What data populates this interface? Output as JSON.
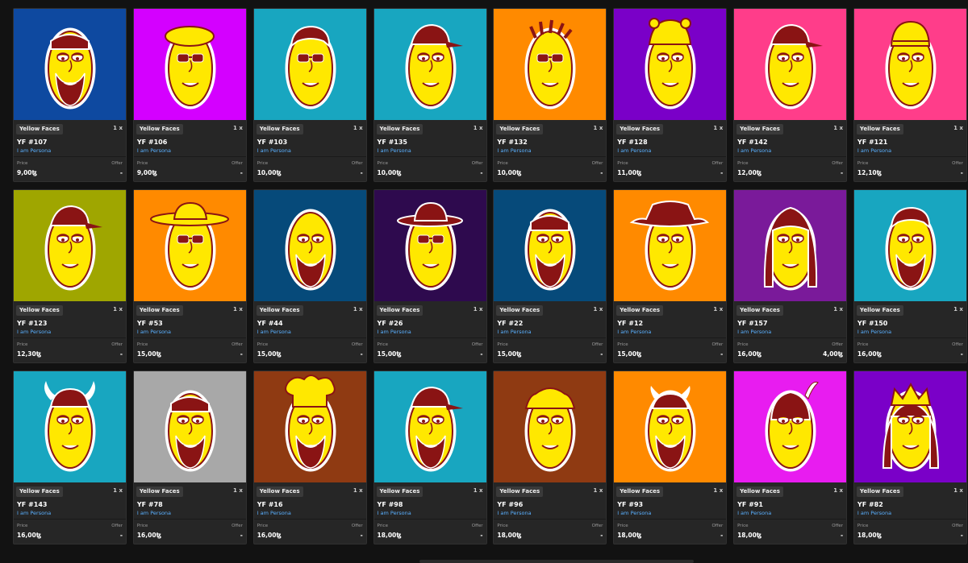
{
  "cards": [
    {
      "bg": "#0e49a0",
      "hat": "bandana",
      "beard": true,
      "glasses": false,
      "title": "YF #107",
      "collection": "Yellow Faces",
      "creator": "I am Persona",
      "qty": "1 x",
      "price_label": "Price",
      "offer_label": "Offer",
      "price": "9,00ꜩ",
      "offer": "-"
    },
    {
      "bg": "#d400ff",
      "hat": "beret",
      "beard": false,
      "glasses": true,
      "title": "YF #106",
      "collection": "Yellow Faces",
      "creator": "I am Persona",
      "qty": "1 x",
      "price_label": "Price",
      "offer_label": "Offer",
      "price": "9,00ꜩ",
      "offer": "-"
    },
    {
      "bg": "#18a6c0",
      "hat": "hair",
      "beard": false,
      "glasses": true,
      "title": "YF #103",
      "collection": "Yellow Faces",
      "creator": "I am Persona",
      "qty": "1 x",
      "price_label": "Price",
      "offer_label": "Offer",
      "price": "10,00ꜩ",
      "offer": "-"
    },
    {
      "bg": "#18a6c0",
      "hat": "cap",
      "beard": false,
      "glasses": false,
      "title": "YF #135",
      "collection": "Yellow Faces",
      "creator": "I am Persona",
      "qty": "1 x",
      "price_label": "Price",
      "offer_label": "Offer",
      "price": "10,00ꜩ",
      "offer": "-"
    },
    {
      "bg": "#ff8a00",
      "hat": "dreads",
      "beard": false,
      "glasses": true,
      "title": "YF #132",
      "collection": "Yellow Faces",
      "creator": "I am Persona",
      "qty": "1 x",
      "price_label": "Price",
      "offer_label": "Offer",
      "price": "10,00ꜩ",
      "offer": "-"
    },
    {
      "bg": "#7a00c8",
      "hat": "bear",
      "beard": false,
      "glasses": false,
      "title": "YF #128",
      "collection": "Yellow Faces",
      "creator": "I am Persona",
      "qty": "1 x",
      "price_label": "Price",
      "offer_label": "Offer",
      "price": "11,00ꜩ",
      "offer": "-"
    },
    {
      "bg": "#ff3d8a",
      "hat": "cap",
      "beard": false,
      "glasses": false,
      "title": "YF #142",
      "collection": "Yellow Faces",
      "creator": "I am Persona",
      "qty": "1 x",
      "price_label": "Price",
      "offer_label": "Offer",
      "price": "12,00ꜩ",
      "offer": "-"
    },
    {
      "bg": "#ff3d8a",
      "hat": "beanie",
      "beard": false,
      "glasses": false,
      "title": "YF #121",
      "collection": "Yellow Faces",
      "creator": "I am Persona",
      "qty": "1 x",
      "price_label": "Price",
      "offer_label": "Offer",
      "price": "12,10ꜩ",
      "offer": "-"
    },
    {
      "bg": "#9fa600",
      "hat": "cap",
      "beard": false,
      "glasses": false,
      "title": "YF #123",
      "collection": "Yellow Faces",
      "creator": "I am Persona",
      "qty": "1 x",
      "price_label": "Price",
      "offer_label": "Offer",
      "price": "12,30ꜩ",
      "offer": "-"
    },
    {
      "bg": "#ff8a00",
      "hat": "wide",
      "beard": false,
      "glasses": true,
      "title": "YF #53",
      "collection": "Yellow Faces",
      "creator": "I am Persona",
      "qty": "1 x",
      "price_label": "Price",
      "offer_label": "Offer",
      "price": "15,00ꜩ",
      "offer": "-"
    },
    {
      "bg": "#064a7a",
      "hat": "none",
      "beard": true,
      "glasses": false,
      "title": "YF #44",
      "collection": "Yellow Faces",
      "creator": "I am Persona",
      "qty": "1 x",
      "price_label": "Price",
      "offer_label": "Offer",
      "price": "15,00ꜩ",
      "offer": "-"
    },
    {
      "bg": "#2e0a4e",
      "hat": "fedora",
      "beard": false,
      "glasses": true,
      "title": "YF #26",
      "collection": "Yellow Faces",
      "creator": "I am Persona",
      "qty": "1 x",
      "price_label": "Price",
      "offer_label": "Offer",
      "price": "15,00ꜩ",
      "offer": "-"
    },
    {
      "bg": "#064a7a",
      "hat": "bandana",
      "beard": true,
      "glasses": false,
      "title": "YF #22",
      "collection": "Yellow Faces",
      "creator": "I am Persona",
      "qty": "1 x",
      "price_label": "Price",
      "offer_label": "Offer",
      "price": "15,00ꜩ",
      "offer": "-"
    },
    {
      "bg": "#ff8a00",
      "hat": "cowboy",
      "beard": false,
      "glasses": false,
      "title": "YF #12",
      "collection": "Yellow Faces",
      "creator": "I am Persona",
      "qty": "1 x",
      "price_label": "Price",
      "offer_label": "Offer",
      "price": "15,00ꜩ",
      "offer": "-"
    },
    {
      "bg": "#7a1a9a",
      "hat": "longhair",
      "beard": false,
      "glasses": false,
      "title": "YF #157",
      "collection": "Yellow Faces",
      "creator": "I am Persona",
      "qty": "1 x",
      "price_label": "Price",
      "offer_label": "Offer",
      "price": "16,00ꜩ",
      "offer": "4,00ꜩ"
    },
    {
      "bg": "#18a6c0",
      "hat": "hair",
      "beard": true,
      "glasses": false,
      "title": "YF #150",
      "collection": "Yellow Faces",
      "creator": "I am Persona",
      "qty": "1 x",
      "price_label": "Price",
      "offer_label": "Offer",
      "price": "16,00ꜩ",
      "offer": "-"
    },
    {
      "bg": "#18a6c0",
      "hat": "viking",
      "beard": false,
      "glasses": false,
      "title": "YF #143",
      "collection": "Yellow Faces",
      "creator": "I am Persona",
      "qty": "1 x",
      "price_label": "Price",
      "offer_label": "Offer",
      "price": "16,00ꜩ",
      "offer": "-"
    },
    {
      "bg": "#a8a8a8",
      "hat": "bandana",
      "beard": true,
      "glasses": false,
      "title": "YF #78",
      "collection": "Yellow Faces",
      "creator": "I am Persona",
      "qty": "1 x",
      "price_label": "Price",
      "offer_label": "Offer",
      "price": "16,00ꜩ",
      "offer": "-"
    },
    {
      "bg": "#8f3a12",
      "hat": "chef",
      "beard": true,
      "glasses": false,
      "title": "YF #16",
      "collection": "Yellow Faces",
      "creator": "I am Persona",
      "qty": "1 x",
      "price_label": "Price",
      "offer_label": "Offer",
      "price": "16,00ꜩ",
      "offer": "-"
    },
    {
      "bg": "#18a6c0",
      "hat": "cap",
      "beard": true,
      "glasses": false,
      "title": "YF #98",
      "collection": "Yellow Faces",
      "creator": "I am Persona",
      "qty": "1 x",
      "price_label": "Price",
      "offer_label": "Offer",
      "price": "18,00ꜩ",
      "offer": "-"
    },
    {
      "bg": "#8f3a12",
      "hat": "bucket",
      "beard": false,
      "glasses": false,
      "title": "YF #96",
      "collection": "Yellow Faces",
      "creator": "I am Persona",
      "qty": "1 x",
      "price_label": "Price",
      "offer_label": "Offer",
      "price": "18,00ꜩ",
      "offer": "-"
    },
    {
      "bg": "#ff8a00",
      "hat": "horns",
      "beard": true,
      "glasses": false,
      "title": "YF #93",
      "collection": "Yellow Faces",
      "creator": "I am Persona",
      "qty": "1 x",
      "price_label": "Price",
      "offer_label": "Offer",
      "price": "18,00ꜩ",
      "offer": "-"
    },
    {
      "bg": "#e81cf0",
      "hat": "feather",
      "beard": false,
      "glasses": false,
      "title": "YF #91",
      "collection": "Yellow Faces",
      "creator": "I am Persona",
      "qty": "1 x",
      "price_label": "Price",
      "offer_label": "Offer",
      "price": "18,00ꜩ",
      "offer": "-"
    },
    {
      "bg": "#7a00c8",
      "hat": "crown",
      "beard": false,
      "glasses": false,
      "title": "YF #82",
      "collection": "Yellow Faces",
      "creator": "I am Persona",
      "qty": "1 x",
      "price_label": "Price",
      "offer_label": "Offer",
      "price": "18,00ꜩ",
      "offer": "-"
    }
  ],
  "colors": {
    "face": "#ffe800",
    "outline": "#8a1414",
    "sticker_border": "#ffffff"
  }
}
